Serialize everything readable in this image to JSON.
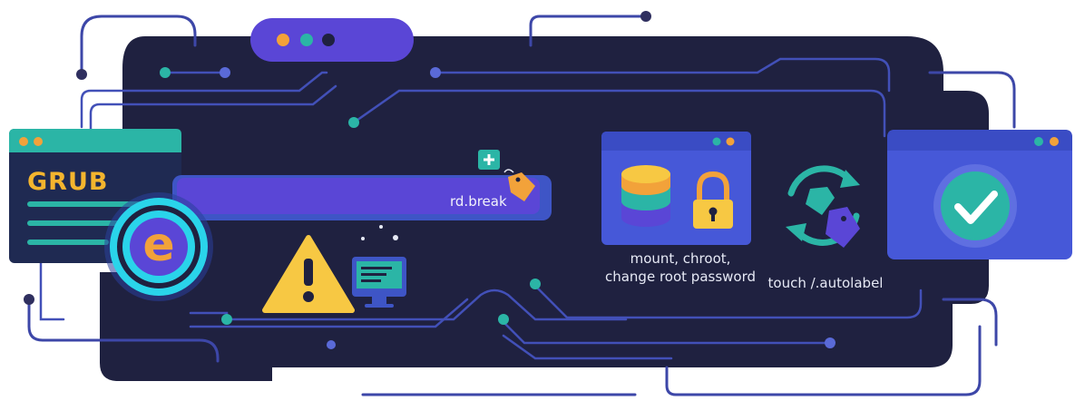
{
  "grub_window": {
    "title": "GRUB"
  },
  "edit_key": {
    "letter": "e"
  },
  "kernel_param": {
    "text": "rd.break"
  },
  "steps": {
    "mount_line1": "mount, chroot,",
    "mount_line2": "change root password",
    "relabel": "touch /.autolabel"
  },
  "icons": [
    "browser-dots-icon",
    "plus-icon",
    "tag-icon",
    "warning-icon",
    "monitor-icon",
    "database-icon",
    "lock-icon",
    "refresh-icon",
    "check-icon"
  ],
  "colors": {
    "panel": "#1f2140",
    "circuit": "#3d47a8",
    "teal": "#2bb5a6",
    "accent_purple": "#5a46d6",
    "orange": "#f2a23a",
    "yellow": "#f7c843",
    "window_blue": "#4658d8"
  }
}
